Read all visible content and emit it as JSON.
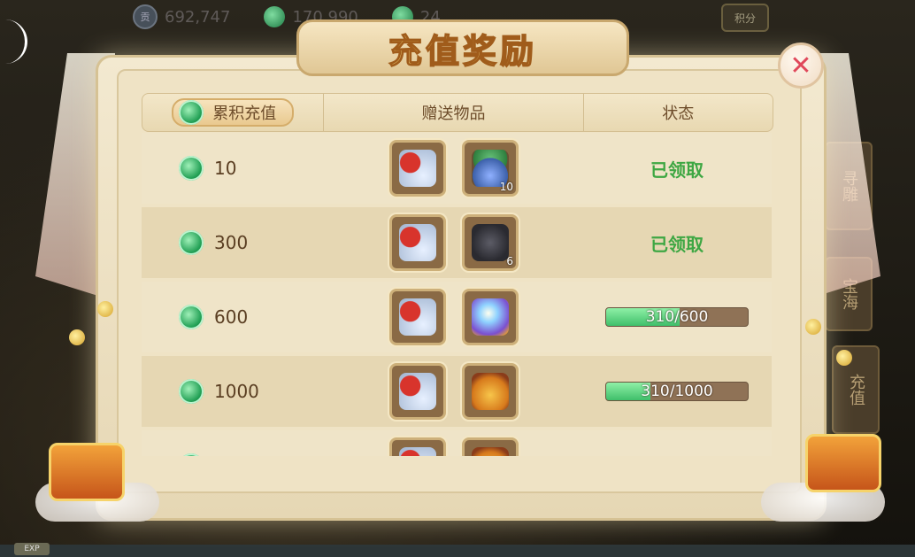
{
  "hud": {
    "currency1": "692,747",
    "currency1_icon_label": "贡",
    "currency2": "170,990",
    "currency3": "24",
    "score_button": "积分"
  },
  "side_tabs": [
    "寻雕",
    "宝海",
    "充值"
  ],
  "exp_label": "EXP",
  "dialog": {
    "title": "充值奖励",
    "close_symbol": "✕",
    "headers": {
      "cumulative": "累积充值",
      "gift_items": "赠送物品",
      "status": "状态"
    },
    "rows": [
      {
        "amount": "10",
        "items": [
          {
            "icon": "silver-coins-bag-icon",
            "qty": ""
          },
          {
            "icon": "jade-plant-vase-icon",
            "qty": "10"
          }
        ],
        "status_type": "claimed",
        "status_text": "已领取"
      },
      {
        "amount": "300",
        "items": [
          {
            "icon": "silver-coins-bag-icon",
            "qty": ""
          },
          {
            "icon": "dark-stone-icon",
            "qty": "6"
          }
        ],
        "status_type": "claimed",
        "status_text": "已领取"
      },
      {
        "amount": "600",
        "items": [
          {
            "icon": "silver-coins-bag-icon",
            "qty": ""
          },
          {
            "icon": "crystal-orb-icon",
            "qty": ""
          }
        ],
        "status_type": "progress",
        "progress_fraction": 0.517,
        "status_text": "310/600"
      },
      {
        "amount": "1000",
        "items": [
          {
            "icon": "silver-coins-bag-icon",
            "qty": ""
          },
          {
            "icon": "gold-lucky-bag-icon",
            "qty": ""
          }
        ],
        "status_type": "progress",
        "progress_fraction": 0.31,
        "status_text": "310/1000"
      }
    ]
  },
  "colors": {
    "claimed_text": "#3ea743",
    "progress_fill": "#5fd37f",
    "title_fill": "#f2d77a"
  }
}
